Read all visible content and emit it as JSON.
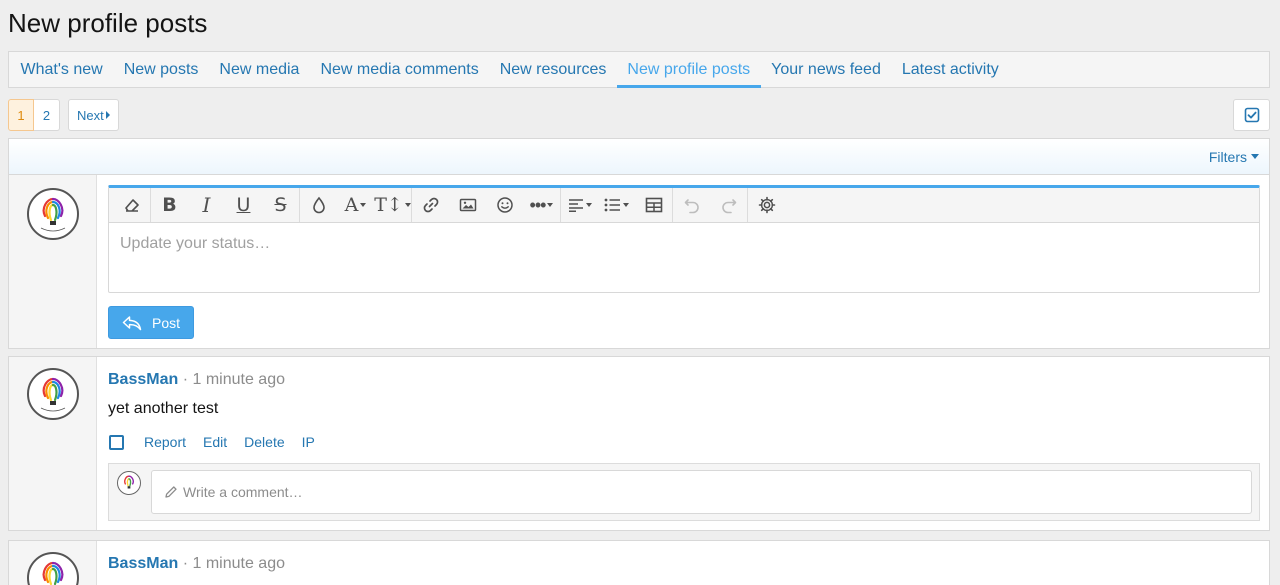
{
  "page": {
    "title": "New profile posts"
  },
  "tabs": [
    {
      "label": "What's new"
    },
    {
      "label": "New posts"
    },
    {
      "label": "New media"
    },
    {
      "label": "New media comments"
    },
    {
      "label": "New resources"
    },
    {
      "label": "New profile posts",
      "active": true
    },
    {
      "label": "Your news feed"
    },
    {
      "label": "Latest activity"
    }
  ],
  "pagination": {
    "pages": [
      "1",
      "2"
    ],
    "current": "1",
    "next_label": "Next"
  },
  "filter_bar": {
    "filters_label": "Filters"
  },
  "composer": {
    "placeholder": "Update your status…",
    "post_label": "Post",
    "toolbar_icons": [
      "eraser-icon",
      "bold-icon",
      "italic-icon",
      "underline-icon",
      "strikethrough-icon",
      "text-color-icon",
      "font-family-icon",
      "font-size-icon",
      "link-icon",
      "image-icon",
      "smilie-icon",
      "more-icon",
      "align-icon",
      "list-icon",
      "table-icon",
      "undo-icon",
      "redo-icon",
      "settings-icon"
    ]
  },
  "posts": [
    {
      "username": "BassMan",
      "separator": "·",
      "time": "1 minute ago",
      "body": "yet another test",
      "actions": [
        "Report",
        "Edit",
        "Delete",
        "IP"
      ],
      "comment_placeholder": "Write a comment…"
    },
    {
      "username": "BassMan",
      "separator": "·",
      "time": "1 minute ago"
    }
  ],
  "colors": {
    "link": "#2577b1",
    "accent": "#47a7eb",
    "current_page": "#df8a0d"
  }
}
